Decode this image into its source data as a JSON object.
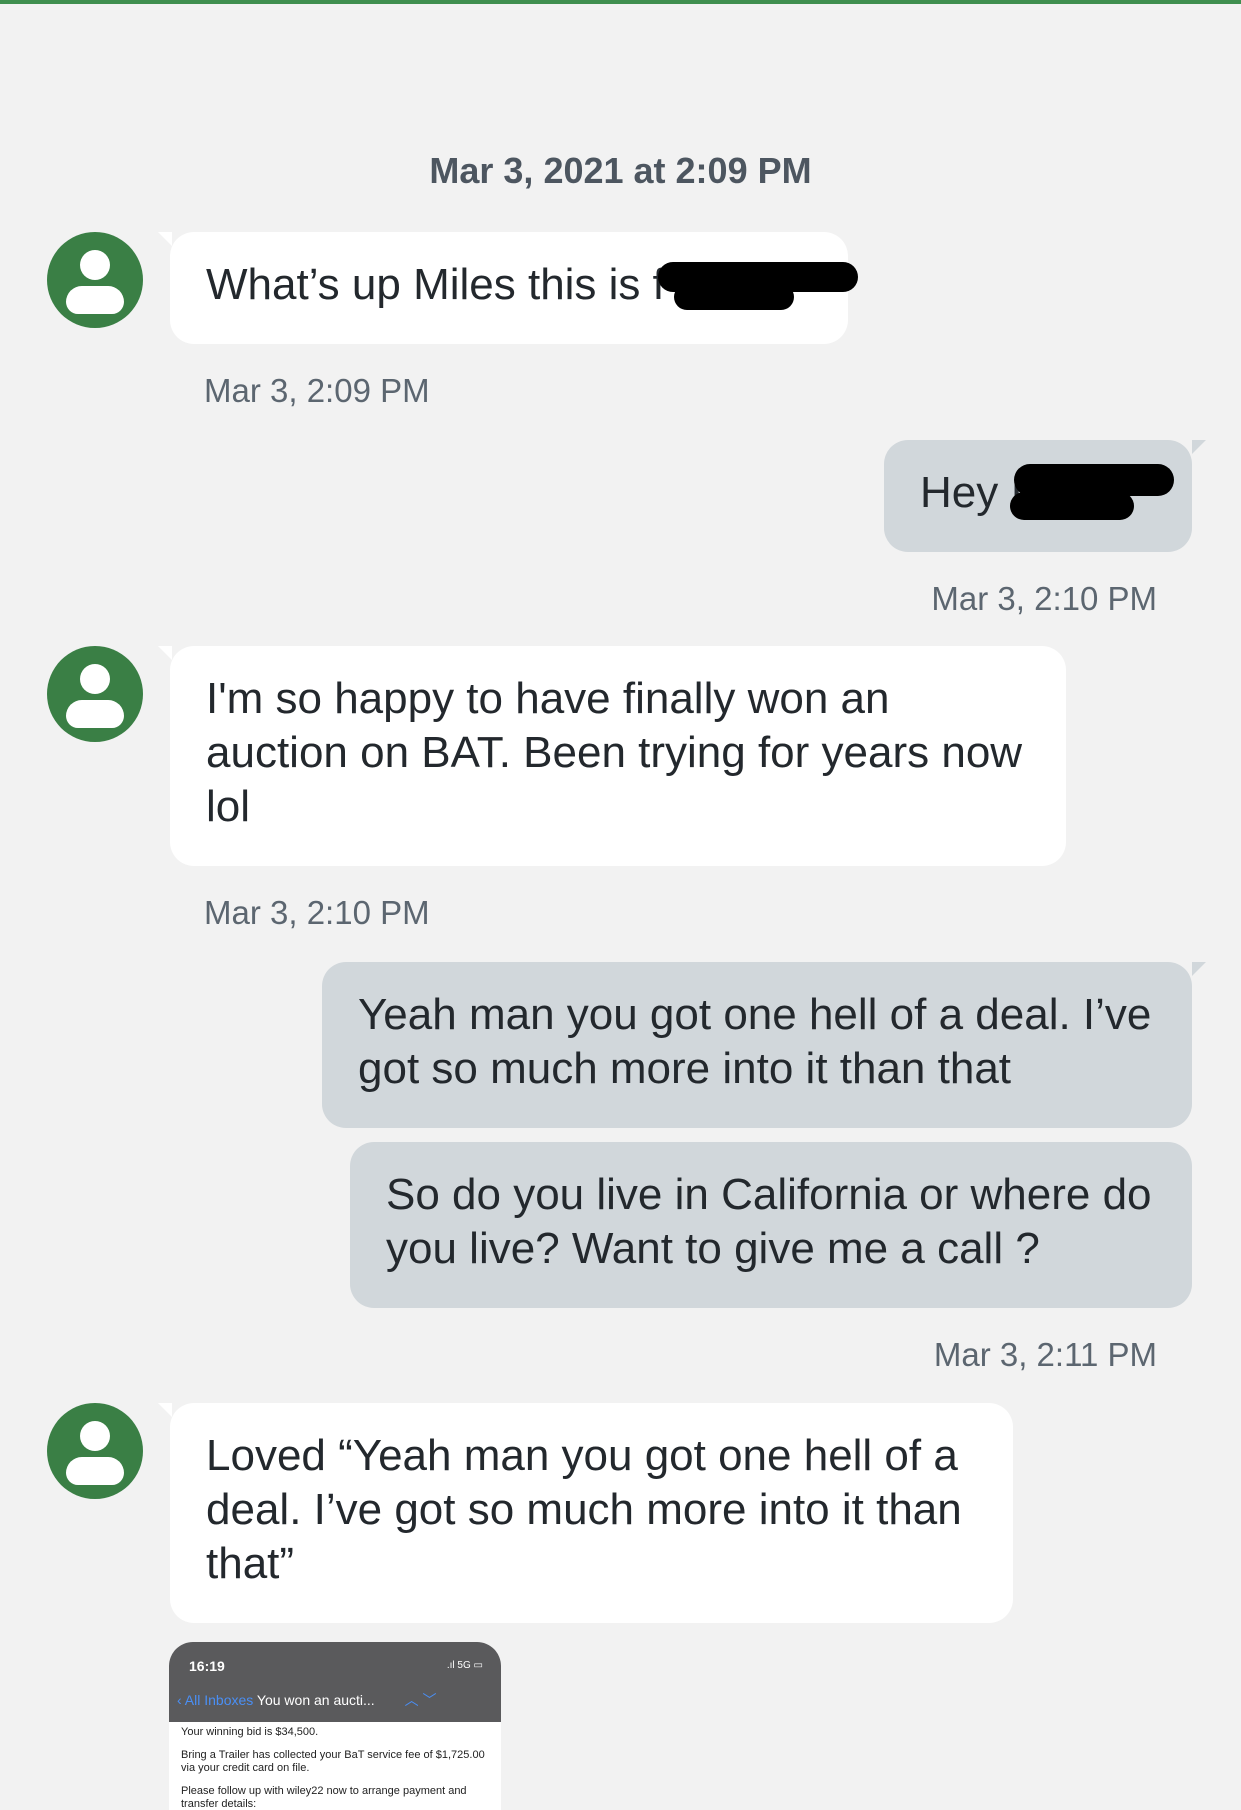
{
  "conversation": {
    "date_header": "Mar 3, 2021 at 2:09 PM",
    "messages": [
      {
        "text": "What’s up Miles this is f",
        "timestamp": "Mar 3, 2:09 PM"
      },
      {
        "text": "Hey I",
        "timestamp": "Mar 3, 2:10 PM"
      },
      {
        "text": "I'm so happy to have finally won an auction on BAT. Been trying for years now lol",
        "timestamp": "Mar 3, 2:10 PM"
      },
      {
        "text": "Yeah man you got one hell of a deal. I’ve got so much more into it than that"
      },
      {
        "text": "So do you live in California or where do you live? Want to give me a call ?",
        "timestamp": "Mar 3, 2:11 PM"
      },
      {
        "text": "Loved “Yeah man you got one hell of a deal. I’ve got so much more into it than that”"
      }
    ]
  },
  "attachment": {
    "status_time": "16:19",
    "signal": ".ıl 5G ▭",
    "back_label": "‹ All Inboxes",
    "subject": "You won an aucti...",
    "nav_arrows": "︿  ﹀",
    "line1": "Your winning bid is $34,500.",
    "line2": "Bring a Trailer has collected your BaT service fee of $1,725.00 via your credit card on file.",
    "line3": "Please follow up with wiley22 now to arrange payment and transfer details:"
  },
  "colors": {
    "accent_green": "#3a7f45",
    "incoming_bubble": "#ffffff",
    "outgoing_bubble": "#d1d7db",
    "background": "#f2f2f2"
  }
}
